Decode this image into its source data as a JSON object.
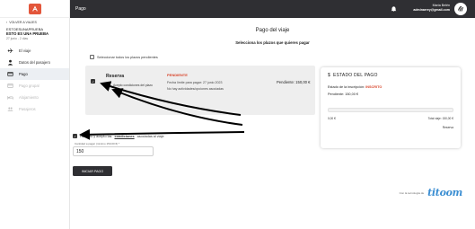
{
  "sidebar": {
    "back": "VOLVER A VIAJES",
    "trip_code": "ESTOESUNAPRUEBA",
    "trip_name": "ESTO ES UNA PRUEBA",
    "trip_dates": "27 junio - 2 días",
    "items": [
      {
        "label": "El viaje",
        "icon": "plane-icon",
        "state": "normal"
      },
      {
        "label": "Datos del pasajero",
        "icon": "person-icon",
        "state": "normal"
      },
      {
        "label": "Pago",
        "icon": "card-icon",
        "state": "active"
      },
      {
        "label": "Pago grupal",
        "icon": "group-card-icon",
        "state": "disabled"
      },
      {
        "label": "Alojamiento",
        "icon": "bed-icon",
        "state": "disabled"
      },
      {
        "label": "Pasajeros",
        "icon": "people-icon",
        "state": "disabled"
      }
    ]
  },
  "topbar": {
    "title": "Pago",
    "user_name": "María Belén",
    "user_email": "adminarrey@gmail.com"
  },
  "main": {
    "title": "Pago del viaje",
    "subtitle": "Selecciona los plazos que quieres pagar",
    "select_all": "Seleccionar todos los plazos pendientes",
    "plan": {
      "name": "Reserva",
      "accept": "Acepto condiciones del plazo",
      "status": "PENDIENTE",
      "deadline": "Fecha límite para pagar: 27 junio 2023",
      "no_activities": "No hay actividades/opciones asociadas",
      "pending": "Pendiente: 150,00 €"
    },
    "status_card": {
      "title": "ESTADO DEL PAGO",
      "inscription_label": "Estado de la inscripción:",
      "inscription_value": "INSCRITO",
      "pending": "Pendiente: 150,00 €",
      "bar_left": "0,00 €",
      "bar_right": "Total viaje: 150,00 €",
      "link": "Reserva"
    },
    "terms_prefix": "He leído y acepto las",
    "terms_bold": "condiciones",
    "terms_suffix": "asociadas al viaje",
    "amount_label": "Cantidad a pagar (mínimo 150,00 €) *",
    "amount_value": "150",
    "pay_button": "INICIAR PAGO",
    "footer_by": "Con la tecnología de",
    "footer_brand": "titoom"
  },
  "colors": {
    "accent": "#e3563b",
    "topbar": "#2f2f33",
    "status": "#d8452b",
    "brand": "#3b8ed2"
  }
}
